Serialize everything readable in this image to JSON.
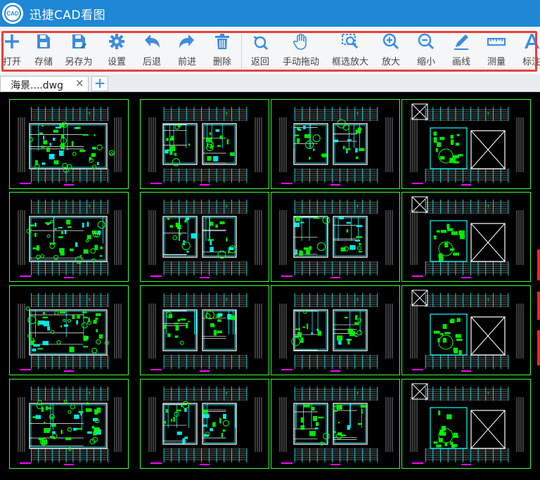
{
  "app": {
    "title": "迅捷CAD看图",
    "logo_text": "CAD"
  },
  "toolbar": {
    "items": [
      {
        "id": "open",
        "label": "打开",
        "icon": "plus-icon"
      },
      {
        "id": "save",
        "label": "存储",
        "icon": "save-icon"
      },
      {
        "id": "saveas",
        "label": "另存为",
        "icon": "save-as-icon"
      },
      {
        "id": "settings",
        "label": "设置",
        "icon": "gear-icon"
      },
      {
        "id": "back",
        "label": "后退",
        "icon": "undo-arrow-icon"
      },
      {
        "id": "forward",
        "label": "前进",
        "icon": "redo-arrow-icon"
      },
      {
        "id": "delete",
        "label": "删除",
        "icon": "trash-icon"
      },
      {
        "id": "return",
        "label": "返回",
        "icon": "return-icon"
      },
      {
        "id": "pan",
        "label": "手动拖动",
        "icon": "hand-icon"
      },
      {
        "id": "window-zoom",
        "label": "框选放大",
        "icon": "window-zoom-icon"
      },
      {
        "id": "zoom-in",
        "label": "放大",
        "icon": "zoom-in-icon"
      },
      {
        "id": "zoom-out",
        "label": "缩小",
        "icon": "zoom-out-icon"
      },
      {
        "id": "draw-line",
        "label": "画线",
        "icon": "pencil-icon"
      },
      {
        "id": "measure",
        "label": "测量",
        "icon": "ruler-icon"
      },
      {
        "id": "annotate",
        "label": "标注",
        "icon": "text-a-icon"
      }
    ],
    "icon_color": "#3d8ce0",
    "highlight_color": "#e8413c"
  },
  "tabs": [
    {
      "label": "海景....dwg",
      "close": "×"
    }
  ],
  "new_tab_label": "+",
  "drawing": {
    "background": "#000000",
    "sheet_border_color": "#3cff3c",
    "line_colors": [
      "#00ffff",
      "#00ff00",
      "#ffffff",
      "#ff00ff",
      "#ffff00"
    ],
    "sheet_rows": 4,
    "sheet_cols": 4
  }
}
